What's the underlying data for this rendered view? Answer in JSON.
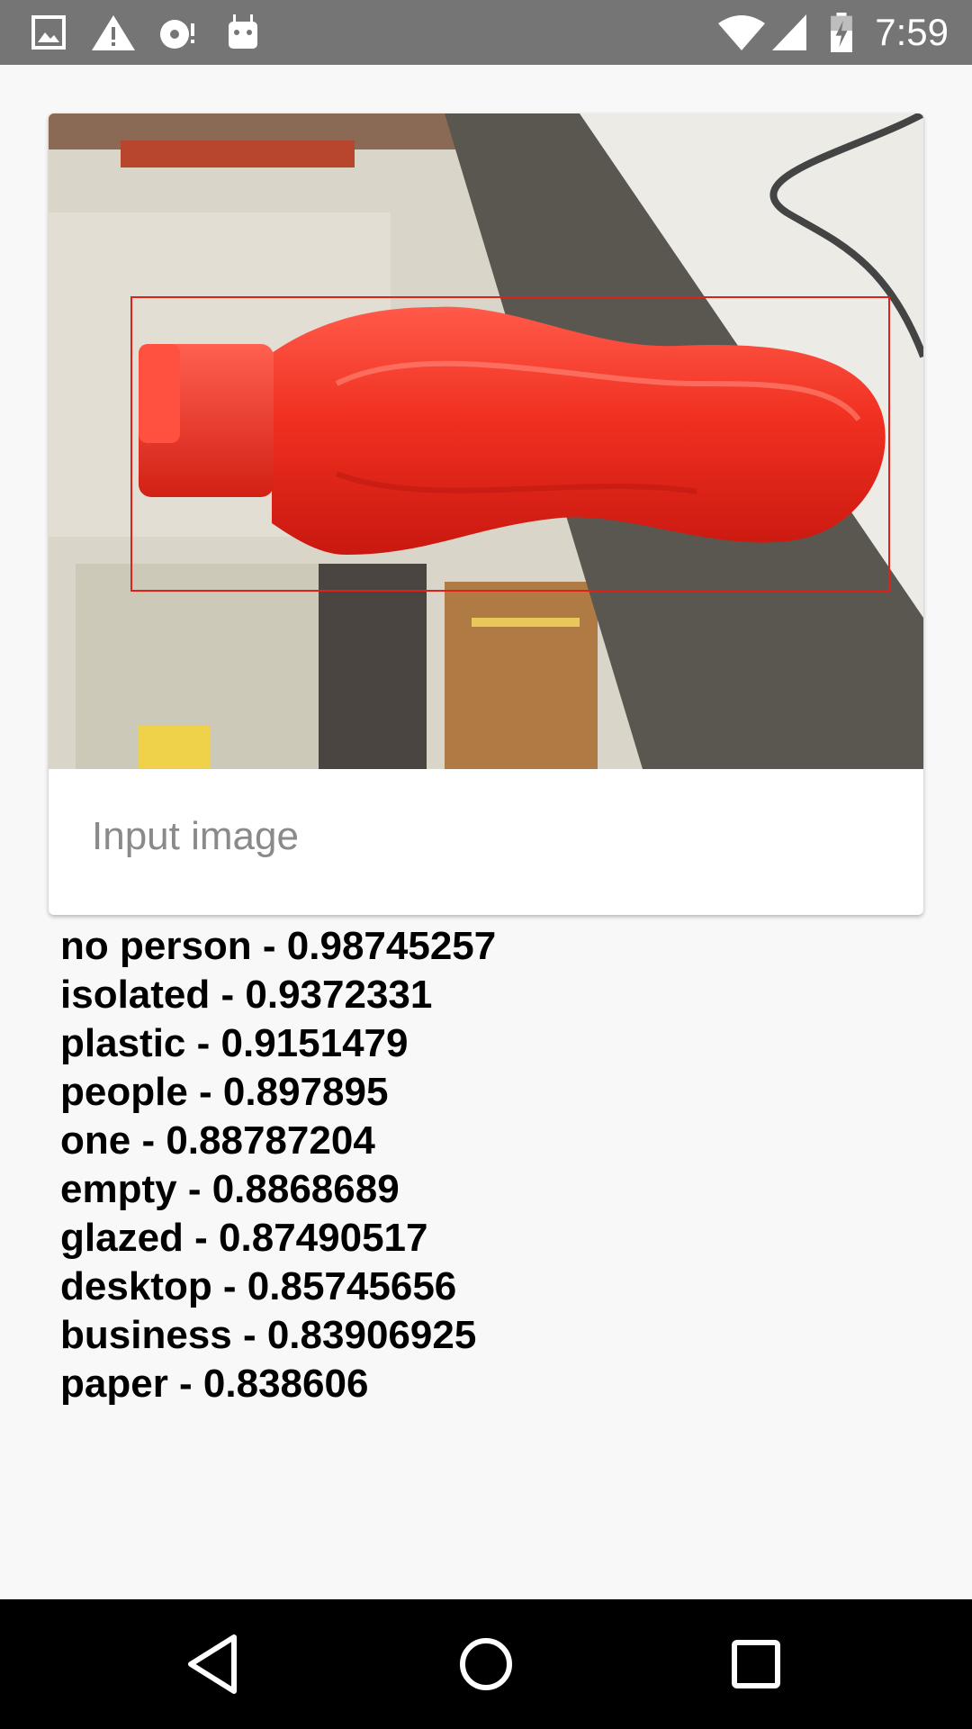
{
  "status_bar": {
    "time": "7:59",
    "left_icons": [
      "image-icon",
      "warning-icon",
      "sync-disc-icon",
      "android-debug-icon"
    ],
    "right_icons": [
      "wifi-icon",
      "signal-icon",
      "battery-charging-icon"
    ]
  },
  "card": {
    "image": "red-water-bottle-photo",
    "caption": "Input image"
  },
  "results": [
    "no person - 0.98745257",
    "isolated - 0.9372331",
    "plastic - 0.9151479",
    "people - 0.897895",
    "one - 0.88787204",
    "empty - 0.8868689",
    "glazed - 0.87490517",
    "desktop - 0.85745656",
    "business - 0.83906925",
    "paper - 0.838606"
  ],
  "nav_bar": {
    "buttons": [
      "back-icon",
      "home-icon",
      "recents-icon"
    ]
  }
}
